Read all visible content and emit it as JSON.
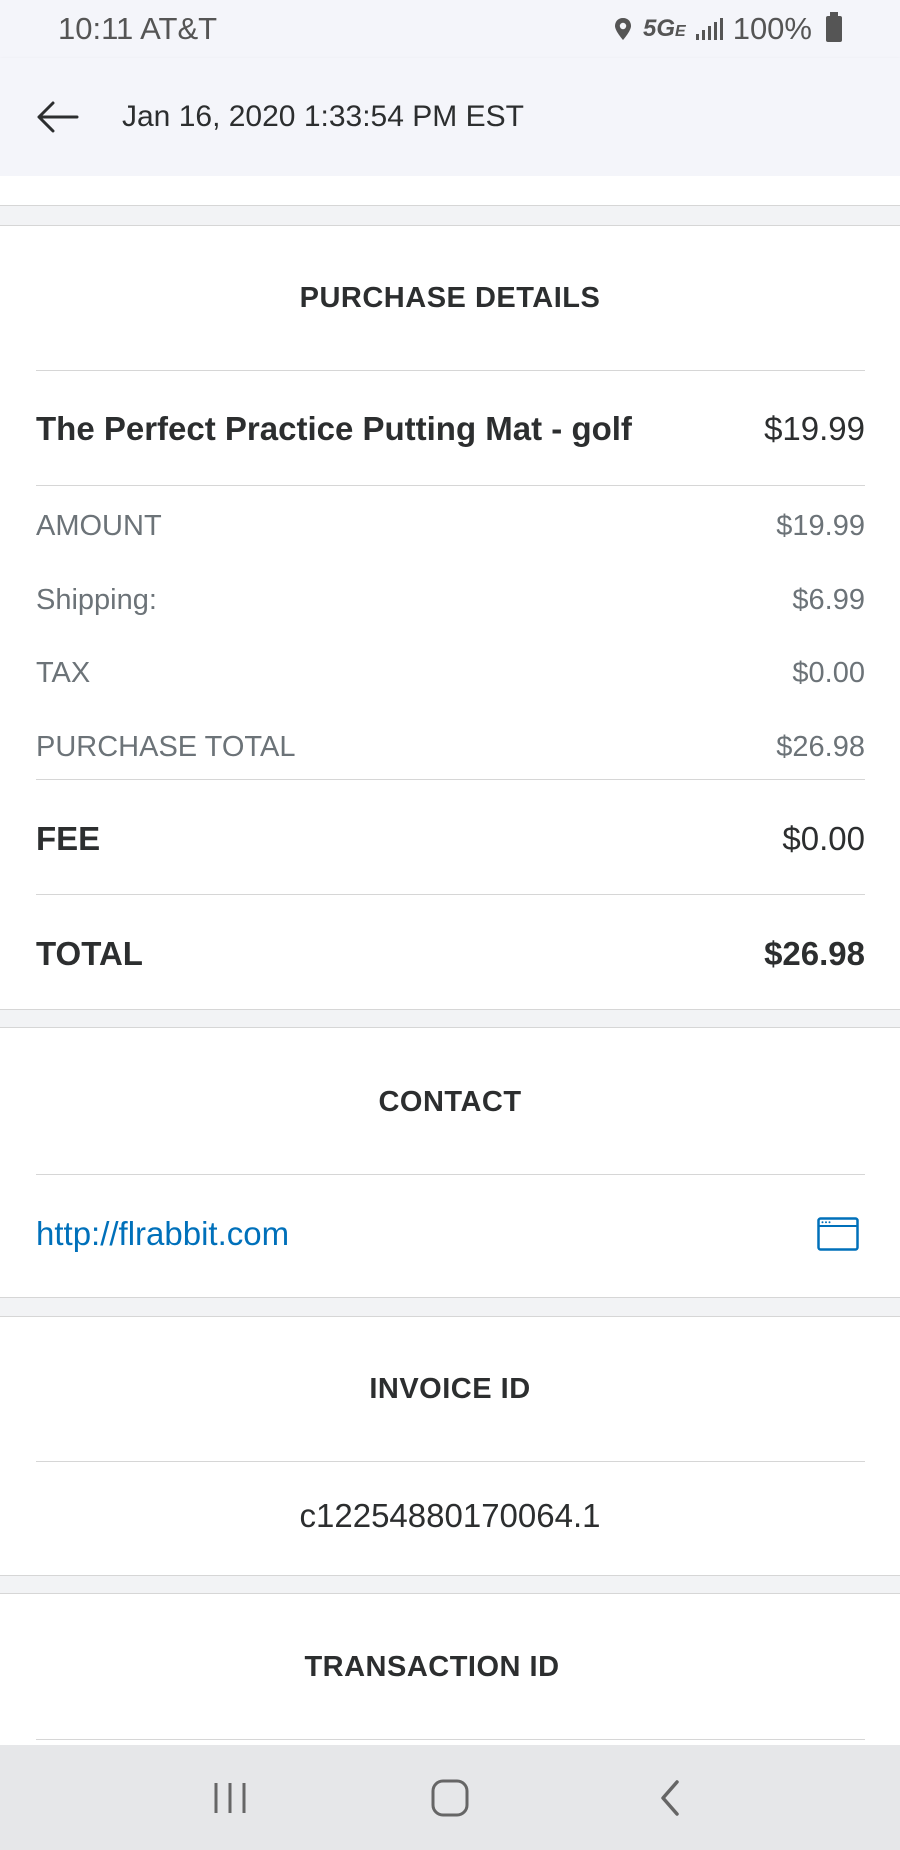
{
  "status_bar": {
    "time_carrier": "10:11 AT&T",
    "network": "5G",
    "network_sub": "E",
    "battery": "100%"
  },
  "header": {
    "title": "Jan 16, 2020 1:33:54 PM EST"
  },
  "purchase": {
    "heading": "PURCHASE DETAILS",
    "item": {
      "name": "The Perfect Practice Putting Mat - golf",
      "price": "$19.99"
    },
    "details": [
      {
        "label": "AMOUNT",
        "value": "$19.99"
      },
      {
        "label": "Shipping:",
        "value": "$6.99"
      },
      {
        "label": "TAX",
        "value": "$0.00"
      },
      {
        "label": "PURCHASE TOTAL",
        "value": "$26.98"
      }
    ],
    "fee": {
      "label": "FEE",
      "value": "$0.00"
    },
    "total": {
      "label": "TOTAL",
      "value": "$26.98"
    }
  },
  "contact": {
    "heading": "CONTACT",
    "url": "http://flrabbit.com",
    "icon": "browser-window-icon"
  },
  "invoice": {
    "heading": "INVOICE ID",
    "value": "c12254880170064.1"
  },
  "transaction": {
    "heading": "TRANSACTION ID"
  },
  "nav": {
    "recents_icon": "recent-apps-icon",
    "home_icon": "home-icon",
    "back_icon": "back-icon"
  },
  "colors": {
    "link": "#0070ba",
    "text": "#2c2e2f",
    "muted": "#6c7378",
    "divider": "#d6d6d6"
  }
}
